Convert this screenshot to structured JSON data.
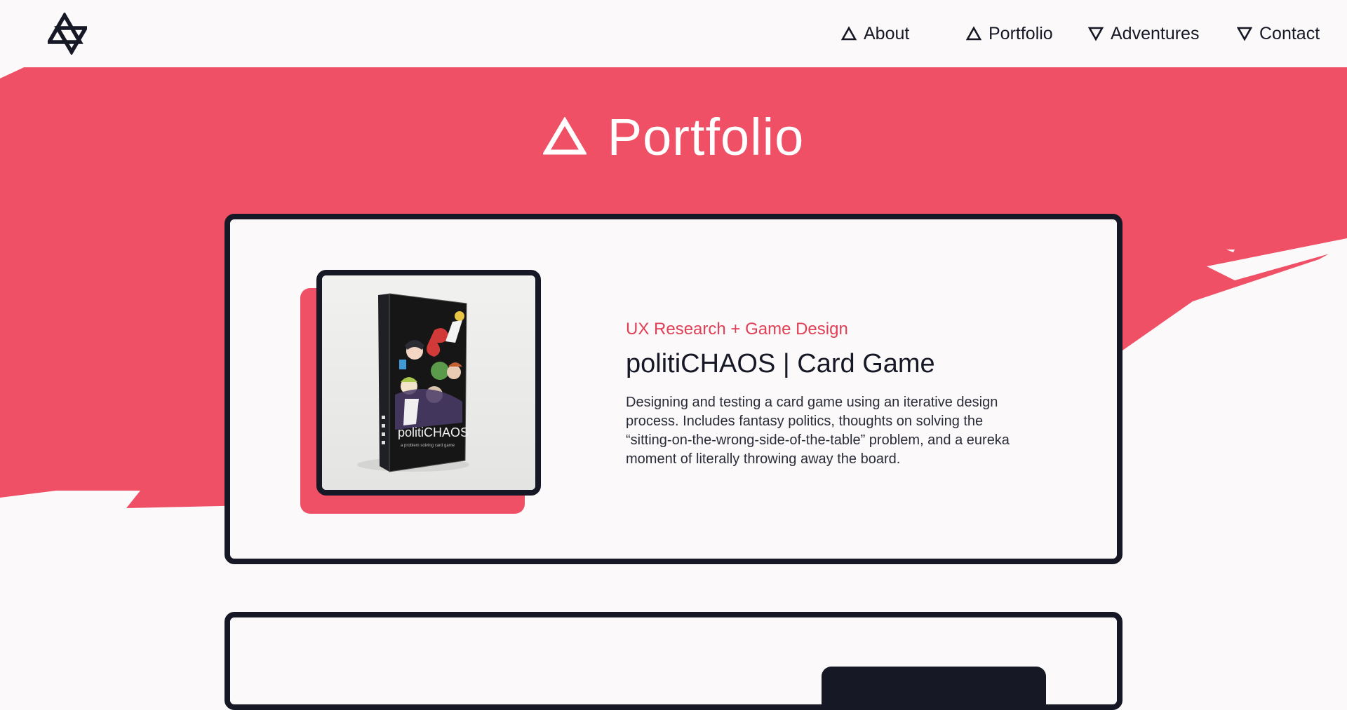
{
  "nav": {
    "items": [
      {
        "label": "About",
        "icon": "triangle-up-icon"
      },
      {
        "label": "Portfolio",
        "icon": "triangle-up-icon"
      },
      {
        "label": "Adventures",
        "icon": "triangle-down-icon"
      },
      {
        "label": "Contact",
        "icon": "triangle-down-icon"
      }
    ]
  },
  "page": {
    "heading": "Portfolio"
  },
  "projects": [
    {
      "kicker": "UX Research + Game Design",
      "title": "politiCHAOS | Card Game",
      "description": "Designing and testing a card game using an iterative design process. Includes fantasy politics, thoughts on solving the “sitting-on-the-wrong-side-of-the-table” problem, and a eureka moment of literally throwing away the board.",
      "box_title": "politiCHAOS",
      "box_tagline": "a problem solving card game"
    }
  ],
  "colors": {
    "accent": "#ef5066",
    "ink": "#161925",
    "background": "#fbf9fa"
  }
}
